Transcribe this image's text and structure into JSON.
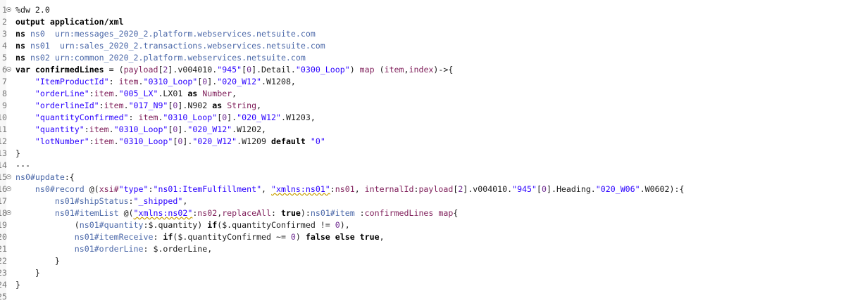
{
  "editor": {
    "line_numbers": [
      "1",
      "2",
      "3",
      "4",
      "5",
      "6",
      "7",
      "8",
      "9",
      "10",
      "11",
      "12",
      "13",
      "14",
      "15",
      "16",
      "17",
      "18",
      "19",
      "20",
      "21",
      "22",
      "23",
      "24",
      "25"
    ],
    "folded_lines": [
      1,
      6,
      15,
      16,
      18
    ],
    "lines": [
      [
        [
          "c",
          "%dw 2.0"
        ]
      ],
      [
        [
          "k",
          "output application/xml"
        ]
      ],
      [
        [
          "k",
          "ns "
        ],
        [
          "n",
          "ns0"
        ],
        [
          "p",
          "  "
        ],
        [
          "n",
          "urn:messages_2020_2.platform.webservices.netsuite.com"
        ]
      ],
      [
        [
          "k",
          "ns "
        ],
        [
          "n",
          "ns01"
        ],
        [
          "p",
          "  "
        ],
        [
          "n",
          "urn:sales_2020_2.transactions.webservices.netsuite.com"
        ]
      ],
      [
        [
          "k",
          "ns "
        ],
        [
          "n",
          "ns02"
        ],
        [
          "p",
          " "
        ],
        [
          "n",
          "urn:common_2020_2.platform.webservices.netsuite.com"
        ]
      ],
      [
        [
          "k",
          "var confirmedLines"
        ],
        [
          "p",
          " = ("
        ],
        [
          "t",
          "payload"
        ],
        [
          "p",
          "["
        ],
        [
          "m",
          "2"
        ],
        [
          "p",
          "].v004010."
        ],
        [
          "s",
          "\"945\""
        ],
        [
          "p",
          "["
        ],
        [
          "m",
          "0"
        ],
        [
          "p",
          "].Detail."
        ],
        [
          "s",
          "\"0300_Loop\""
        ],
        [
          "p",
          ") "
        ],
        [
          "t",
          "map"
        ],
        [
          "p",
          " ("
        ],
        [
          "t",
          "item"
        ],
        [
          "p",
          ","
        ],
        [
          "t",
          "index"
        ],
        [
          "p",
          ")->{"
        ]
      ],
      [
        [
          "p",
          "    "
        ],
        [
          "s",
          "\"ItemProductId\""
        ],
        [
          "p",
          ": "
        ],
        [
          "t",
          "item"
        ],
        [
          "p",
          "."
        ],
        [
          "s",
          "\"0310_Loop\""
        ],
        [
          "p",
          "["
        ],
        [
          "m",
          "0"
        ],
        [
          "p",
          "]."
        ],
        [
          "s",
          "\"020_W12\""
        ],
        [
          "p",
          ".W1208,"
        ]
      ],
      [
        [
          "p",
          "    "
        ],
        [
          "s",
          "\"orderLine\""
        ],
        [
          "p",
          ":"
        ],
        [
          "t",
          "item"
        ],
        [
          "p",
          "."
        ],
        [
          "s",
          "\"005_LX\""
        ],
        [
          "p",
          ".LX01 "
        ],
        [
          "k",
          "as"
        ],
        [
          "p",
          " "
        ],
        [
          "t",
          "Number"
        ],
        [
          "p",
          ","
        ]
      ],
      [
        [
          "p",
          "    "
        ],
        [
          "s",
          "\"orderlineId\""
        ],
        [
          "p",
          ":"
        ],
        [
          "t",
          "item"
        ],
        [
          "p",
          "."
        ],
        [
          "s",
          "\"017_N9\""
        ],
        [
          "p",
          "["
        ],
        [
          "m",
          "0"
        ],
        [
          "p",
          "].N902 "
        ],
        [
          "k",
          "as"
        ],
        [
          "p",
          " "
        ],
        [
          "t",
          "String"
        ],
        [
          "p",
          ","
        ]
      ],
      [
        [
          "p",
          "    "
        ],
        [
          "s",
          "\"quantityConfirmed\""
        ],
        [
          "p",
          ": "
        ],
        [
          "t",
          "item"
        ],
        [
          "p",
          "."
        ],
        [
          "s",
          "\"0310_Loop\""
        ],
        [
          "p",
          "["
        ],
        [
          "m",
          "0"
        ],
        [
          "p",
          "]."
        ],
        [
          "s",
          "\"020_W12\""
        ],
        [
          "p",
          ".W1203,"
        ]
      ],
      [
        [
          "p",
          "    "
        ],
        [
          "s",
          "\"quantity\""
        ],
        [
          "p",
          ":"
        ],
        [
          "t",
          "item"
        ],
        [
          "p",
          "."
        ],
        [
          "s",
          "\"0310_Loop\""
        ],
        [
          "p",
          "["
        ],
        [
          "m",
          "0"
        ],
        [
          "p",
          "]."
        ],
        [
          "s",
          "\"020_W12\""
        ],
        [
          "p",
          ".W1202,"
        ]
      ],
      [
        [
          "p",
          "    "
        ],
        [
          "s",
          "\"lotNumber\""
        ],
        [
          "p",
          ":"
        ],
        [
          "t",
          "item"
        ],
        [
          "p",
          "."
        ],
        [
          "s",
          "\"0310_Loop\""
        ],
        [
          "p",
          "["
        ],
        [
          "m",
          "0"
        ],
        [
          "p",
          "]."
        ],
        [
          "s",
          "\"020_W12\""
        ],
        [
          "p",
          ".W1209 "
        ],
        [
          "k",
          "default"
        ],
        [
          "p",
          " "
        ],
        [
          "s",
          "\"0\""
        ]
      ],
      [
        [
          "p",
          "}"
        ]
      ],
      [
        [
          "p",
          "---"
        ]
      ],
      [
        [
          "n",
          "ns0#update"
        ],
        [
          "p",
          ":{"
        ]
      ],
      [
        [
          "p",
          "    "
        ],
        [
          "n",
          "ns0#record"
        ],
        [
          "p",
          " @("
        ],
        [
          "t",
          "xsi#"
        ],
        [
          "s",
          "\"type\""
        ],
        [
          "p",
          ":"
        ],
        [
          "s",
          "\"ns01:ItemFulfillment\""
        ],
        [
          "p",
          ", "
        ],
        [
          "q",
          "\"xmlns:ns01\""
        ],
        [
          "p",
          ":"
        ],
        [
          "t",
          "ns01"
        ],
        [
          "p",
          ", "
        ],
        [
          "t",
          "internalId"
        ],
        [
          "p",
          ":"
        ],
        [
          "t",
          "payload"
        ],
        [
          "p",
          "["
        ],
        [
          "m",
          "2"
        ],
        [
          "p",
          "].v004010."
        ],
        [
          "s",
          "\"945\""
        ],
        [
          "p",
          "["
        ],
        [
          "m",
          "0"
        ],
        [
          "p",
          "].Heading."
        ],
        [
          "s",
          "\"020_W06\""
        ],
        [
          "p",
          ".W0602):{"
        ]
      ],
      [
        [
          "p",
          "        "
        ],
        [
          "n",
          "ns01#shipStatus"
        ],
        [
          "p",
          ":"
        ],
        [
          "s",
          "\"_shipped\""
        ],
        [
          "p",
          ","
        ]
      ],
      [
        [
          "p",
          "        "
        ],
        [
          "n",
          "ns01#itemList"
        ],
        [
          "p",
          " @("
        ],
        [
          "q",
          "\"xmlns:ns02\""
        ],
        [
          "p",
          ":"
        ],
        [
          "t",
          "ns02"
        ],
        [
          "p",
          ","
        ],
        [
          "t",
          "replaceAll"
        ],
        [
          "p",
          ": "
        ],
        [
          "k",
          "true"
        ],
        [
          "p",
          "):"
        ],
        [
          "n",
          "ns01#item"
        ],
        [
          "p",
          " :"
        ],
        [
          "t",
          "confirmedLines"
        ],
        [
          "p",
          " "
        ],
        [
          "t",
          "map"
        ],
        [
          "p",
          "{"
        ]
      ],
      [
        [
          "p",
          "            ("
        ],
        [
          "n",
          "ns01#quantity"
        ],
        [
          "p",
          ":$.quantity) "
        ],
        [
          "k",
          "if"
        ],
        [
          "p",
          "($.quantityConfirmed != "
        ],
        [
          "m",
          "0"
        ],
        [
          "p",
          "),"
        ]
      ],
      [
        [
          "p",
          "            "
        ],
        [
          "n",
          "ns01#itemReceive"
        ],
        [
          "p",
          ": "
        ],
        [
          "k",
          "if"
        ],
        [
          "p",
          "($.quantityConfirmed ~= "
        ],
        [
          "m",
          "0"
        ],
        [
          "p",
          ") "
        ],
        [
          "k",
          "false else true"
        ],
        [
          "p",
          ","
        ]
      ],
      [
        [
          "p",
          "            "
        ],
        [
          "n",
          "ns01#orderLine"
        ],
        [
          "p",
          ": $.orderLine,"
        ]
      ],
      [
        [
          "p",
          "        }"
        ]
      ],
      [
        [
          "p",
          "    }"
        ]
      ],
      [
        [
          "p",
          "}"
        ]
      ],
      [
        [
          "p",
          ""
        ]
      ]
    ],
    "colors": {
      "keyword": "#000000",
      "namespace": "#4a67a8",
      "string": "#2a00ff",
      "number": "#6f2c91",
      "identifier": "#7f1e5a",
      "line_number": "#7a7a7a"
    }
  }
}
